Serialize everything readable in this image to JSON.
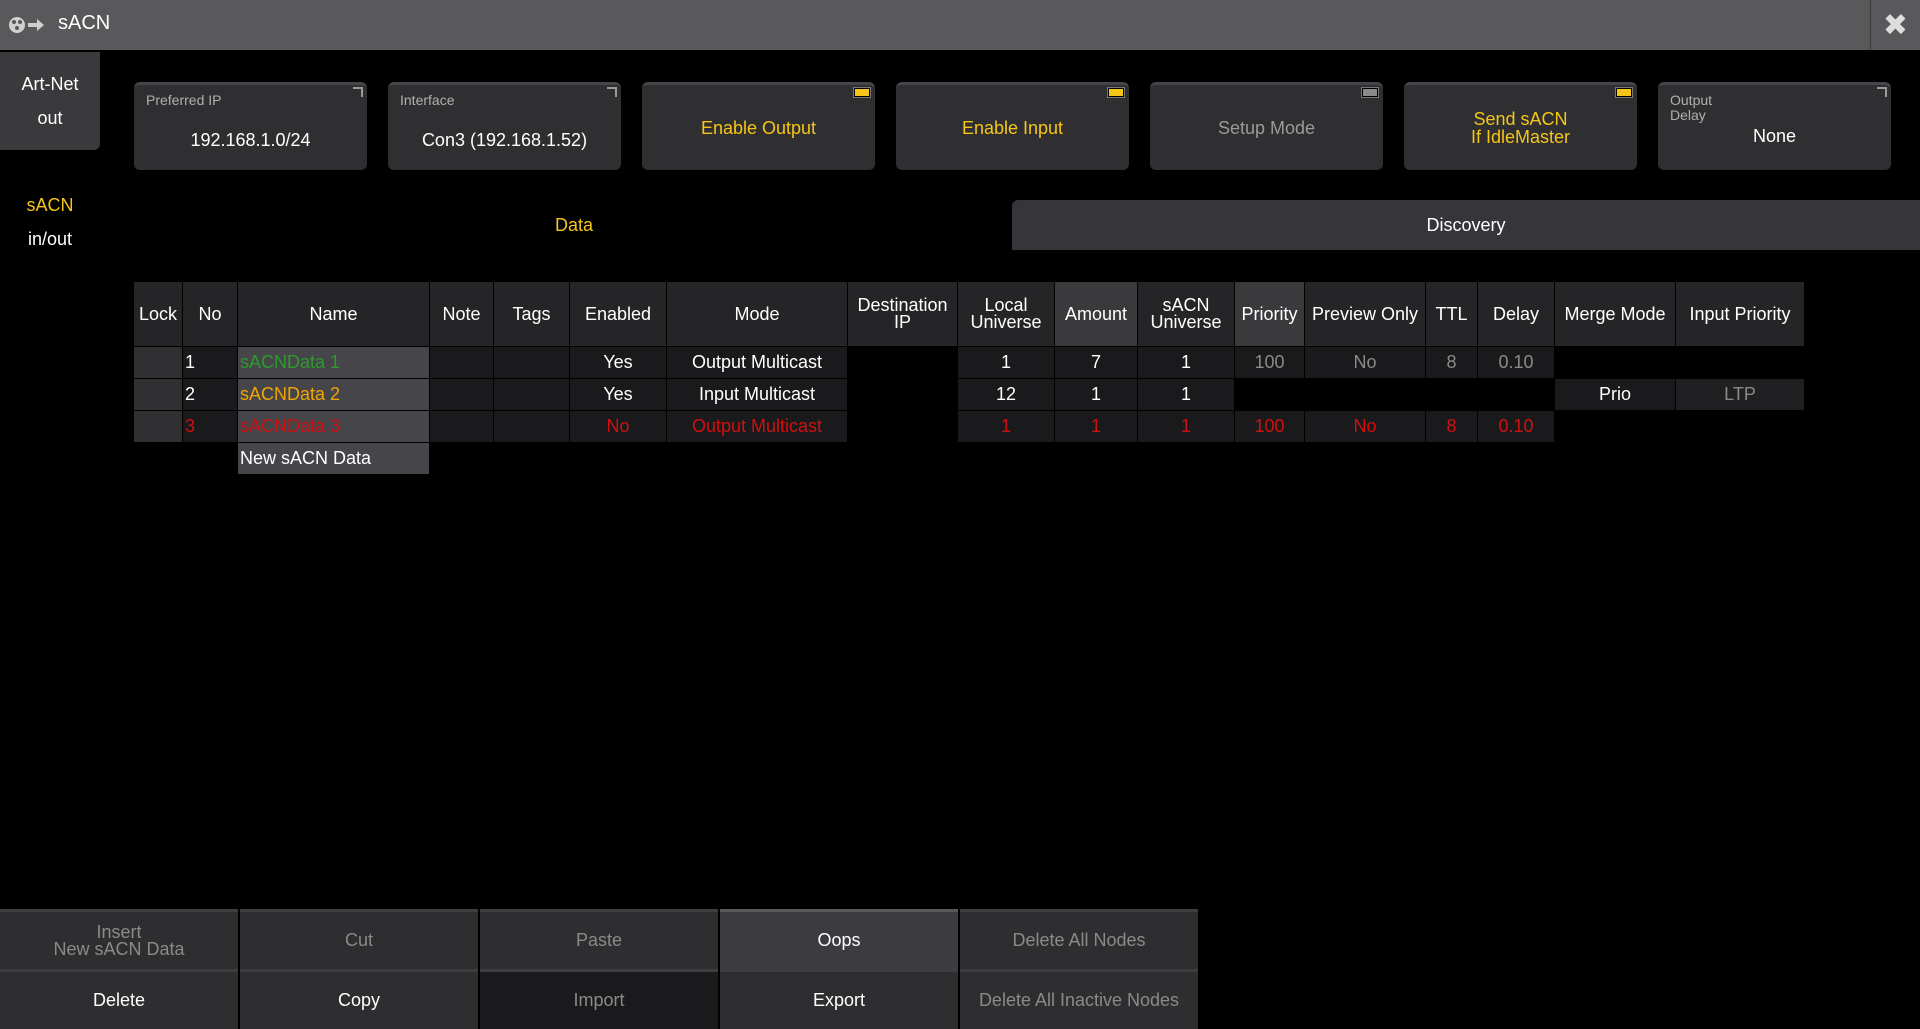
{
  "window": {
    "title": "sACN",
    "close_icon": "close-icon"
  },
  "side_tabs": [
    {
      "line1": "Art-Net",
      "line2": "out"
    },
    {
      "line1": "sACN",
      "line2": "in/out"
    }
  ],
  "top_buttons": {
    "preferred_ip": {
      "label": "Preferred IP",
      "value": "192.168.1.0/24"
    },
    "interface": {
      "label": "Interface",
      "value": "Con3 (192.168.1.52)"
    },
    "enable_output": {
      "value": "Enable Output",
      "led": "on"
    },
    "enable_input": {
      "value": "Enable Input",
      "led": "on"
    },
    "setup_mode": {
      "value": "Setup Mode",
      "led": "off"
    },
    "send_sacn": {
      "line1": "Send sACN",
      "line2": "If IdleMaster",
      "led": "on"
    },
    "output_delay": {
      "label1": "Output",
      "label2": "Delay",
      "value": "None"
    }
  },
  "view_tabs": {
    "data": "Data",
    "discovery": "Discovery"
  },
  "table": {
    "headers": {
      "lock": "Lock",
      "no": "No",
      "name": "Name",
      "note": "Note",
      "tags": "Tags",
      "enabled": "Enabled",
      "mode": "Mode",
      "dest_ip_1": "Destination",
      "dest_ip_2": "IP",
      "local_universe_1": "Local",
      "local_universe_2": "Universe",
      "amount": "Amount",
      "sacn_universe_1": "sACN",
      "sacn_universe_2": "Universe",
      "priority": "Priority",
      "preview_only": "Preview Only",
      "ttl": "TTL",
      "delay": "Delay",
      "merge_mode": "Merge Mode",
      "input_priority": "Input Priority"
    },
    "rows": [
      {
        "no": "1",
        "name": "sACNData 1",
        "enabled": "Yes",
        "mode": "Output Multicast",
        "local_universe": "1",
        "amount": "7",
        "sacn_universe": "1",
        "priority": "100",
        "preview_only": "No",
        "ttl": "8",
        "delay": "0.10",
        "merge_mode": "",
        "input_priority": ""
      },
      {
        "no": "2",
        "name": "sACNData 2",
        "enabled": "Yes",
        "mode": "Input Multicast",
        "local_universe": "12",
        "amount": "1",
        "sacn_universe": "1",
        "priority": "",
        "preview_only": "",
        "ttl": "",
        "delay": "",
        "merge_mode": "Prio",
        "input_priority": "LTP"
      },
      {
        "no": "3",
        "name": "sACNData 3",
        "enabled": "No",
        "mode": "Output Multicast",
        "local_universe": "1",
        "amount": "1",
        "sacn_universe": "1",
        "priority": "100",
        "preview_only": "No",
        "ttl": "8",
        "delay": "0.10",
        "merge_mode": "",
        "input_priority": ""
      }
    ],
    "new_row": "New sACN Data"
  },
  "toolbar": {
    "insert_1": "Insert",
    "insert_2": "New sACN Data",
    "cut": "Cut",
    "paste": "Paste",
    "oops": "Oops",
    "delete_all_nodes": "Delete All Nodes",
    "delete": "Delete",
    "copy": "Copy",
    "import": "Import",
    "export": "Export",
    "delete_all_inactive": "Delete All Inactive Nodes"
  },
  "colors": {
    "accent": "#f5c518",
    "row1": "#2e9a2e",
    "row2": "#f0a500",
    "row3": "#d01010",
    "background": "#000000"
  }
}
